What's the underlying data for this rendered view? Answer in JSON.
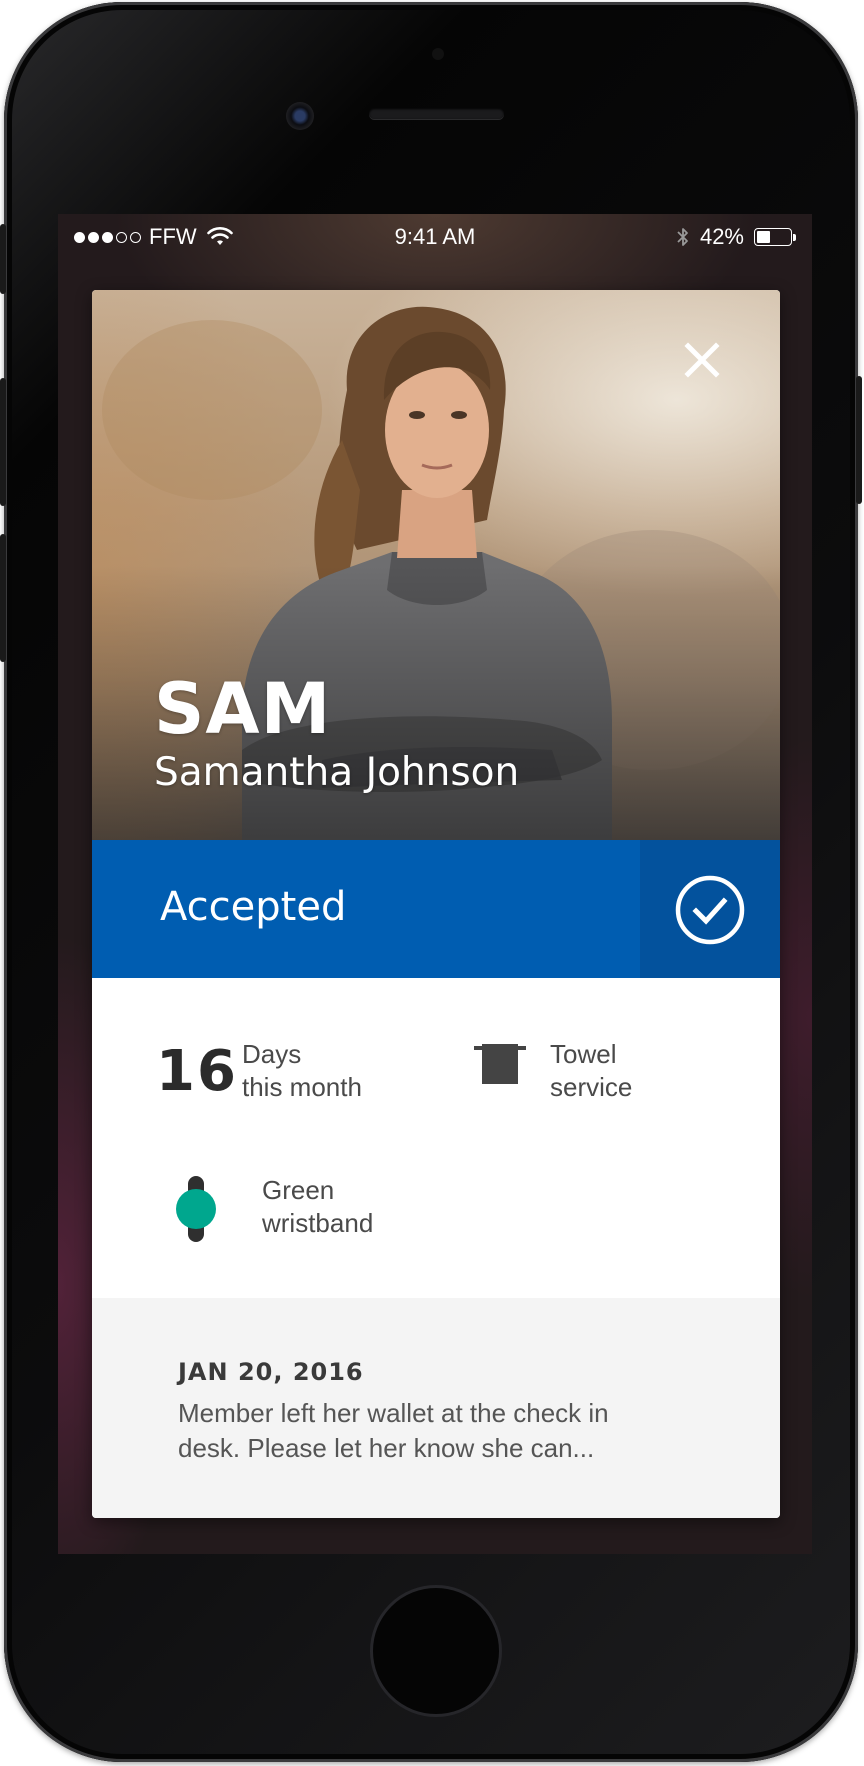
{
  "status_bar": {
    "signal_bars_filled": 3,
    "signal_bars_total": 5,
    "carrier": "FFW",
    "time": "9:41 AM",
    "battery_text": "42%",
    "battery_level": 0.42,
    "icons": [
      "wifi-icon",
      "bluetooth-icon",
      "battery-icon"
    ]
  },
  "member": {
    "nickname": "SAM",
    "full_name": "Samantha Johnson"
  },
  "entry_status": {
    "label": "Accepted",
    "color": "#005db1",
    "icon": "checkmark-circle-icon"
  },
  "stats": {
    "days": {
      "value": "16",
      "line1": "Days",
      "line2": "this month"
    },
    "towel": {
      "line1": "Towel",
      "line2": "service",
      "icon": "towel-icon"
    },
    "wristband": {
      "line1": "Green",
      "line2": "wristband",
      "icon": "wristband-icon",
      "color": "#00a78e"
    }
  },
  "note": {
    "date": "JAN 20, 2016",
    "text": "Member left her wallet at the check in desk. Please let her know she can..."
  }
}
